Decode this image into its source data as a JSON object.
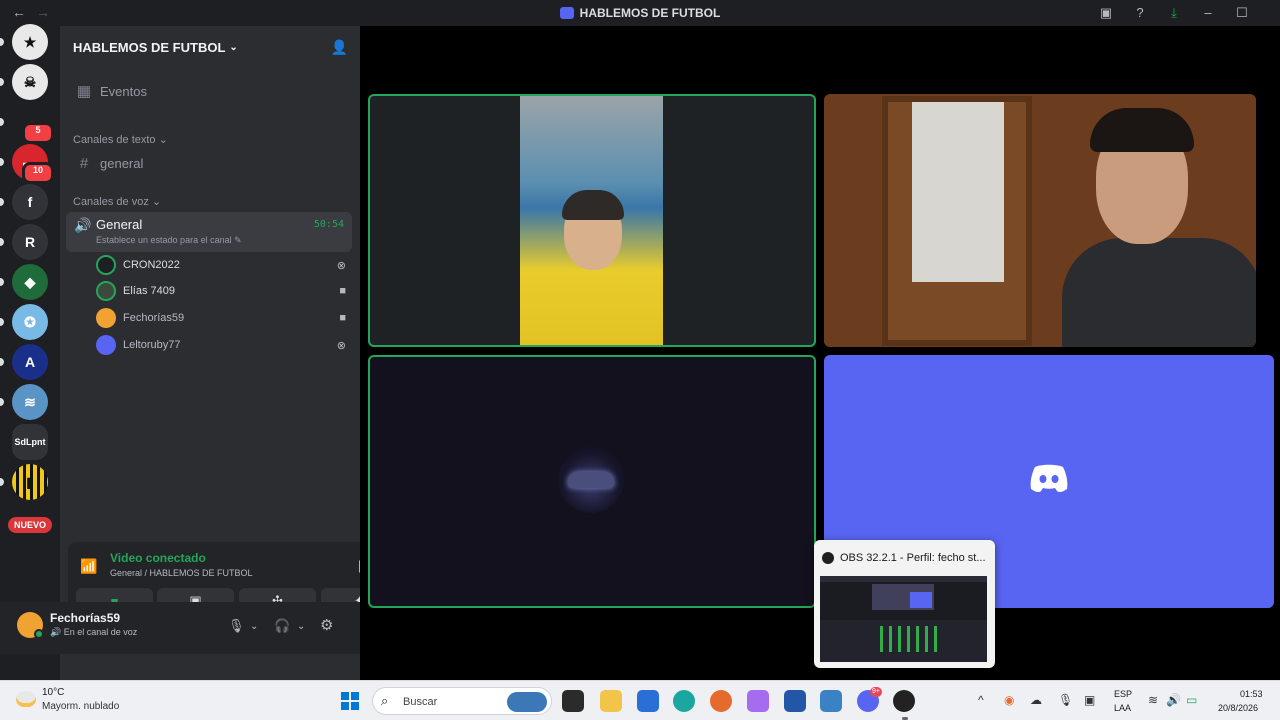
{
  "titlebar": {
    "title": "HABLEMOS DE FUTBOL",
    "back_icon": "arrow-left-icon",
    "forward_icon": "arrow-right-icon",
    "inbox_icon": "inbox-icon",
    "help_icon": "help-icon",
    "download_icon": "download-icon"
  },
  "rail": {
    "servers": [
      {
        "label": "★",
        "color": "#e9e9e9"
      },
      {
        "label": "☠",
        "color": "#e9e9e9"
      },
      {
        "label": "☁",
        "color": "#d8262e",
        "badge": "5"
      },
      {
        "label": "▬",
        "color": "#d8262e",
        "badge": "10"
      },
      {
        "label": "f",
        "color": "#313338"
      },
      {
        "label": "R",
        "color": "#313338"
      },
      {
        "label": "◆",
        "color": "#1f6b3a"
      },
      {
        "label": "✪",
        "color": "#79b9e6"
      },
      {
        "label": "A",
        "color": "#1a2f8a"
      },
      {
        "label": "≋",
        "color": "#5a93c6"
      },
      {
        "label": "SdLpnt",
        "color": "#313338"
      },
      {
        "label": "▮",
        "color": "#1e1f22"
      }
    ],
    "new_label": "NUEVO"
  },
  "sidebar": {
    "guild_name": "HABLEMOS DE FUTBOL",
    "events_label": "Eventos",
    "text_category": "Canales de texto",
    "text_channel": "general",
    "voice_category": "Canales de voz",
    "voice_channel": "General",
    "voice_status": "Establece un estado para el canal",
    "voice_timer": "50:54",
    "members": [
      {
        "name": "CRON2022",
        "status_icon": "xbox-icon",
        "avatar_color": "#1e1f22",
        "glyph": "◎"
      },
      {
        "name": "Elías 7409",
        "status_icon": "video-icon",
        "avatar_color": "#3b4a3a",
        "glyph": "▶"
      },
      {
        "name": "Fechorías59",
        "status_icon": "video-icon",
        "avatar_color": "#f0a232",
        "glyph": "▶"
      },
      {
        "name": "Leltoruby77",
        "status_icon": "xbox-icon",
        "avatar_color": "#5865f2",
        "glyph": "◎"
      }
    ]
  },
  "voice_panel": {
    "status": "Video conectado",
    "location": "General / HABLEMOS DE FUTBOL"
  },
  "user": {
    "name": "Fechorías59",
    "status": "En el canal de voz"
  },
  "popup": {
    "title": "OBS 32.2.1 - Perfil: fecho st..."
  },
  "taskbar": {
    "temp": "10°C",
    "weather": "Mayorm. nublado",
    "search_placeholder": "Buscar",
    "discord_badge": "9+",
    "lang_top": "ESP",
    "lang_bottom": "LAA",
    "time": "01:53",
    "date": "20/8/2026"
  },
  "colors": {
    "accent": "#5865f2",
    "online": "#23a55a"
  }
}
